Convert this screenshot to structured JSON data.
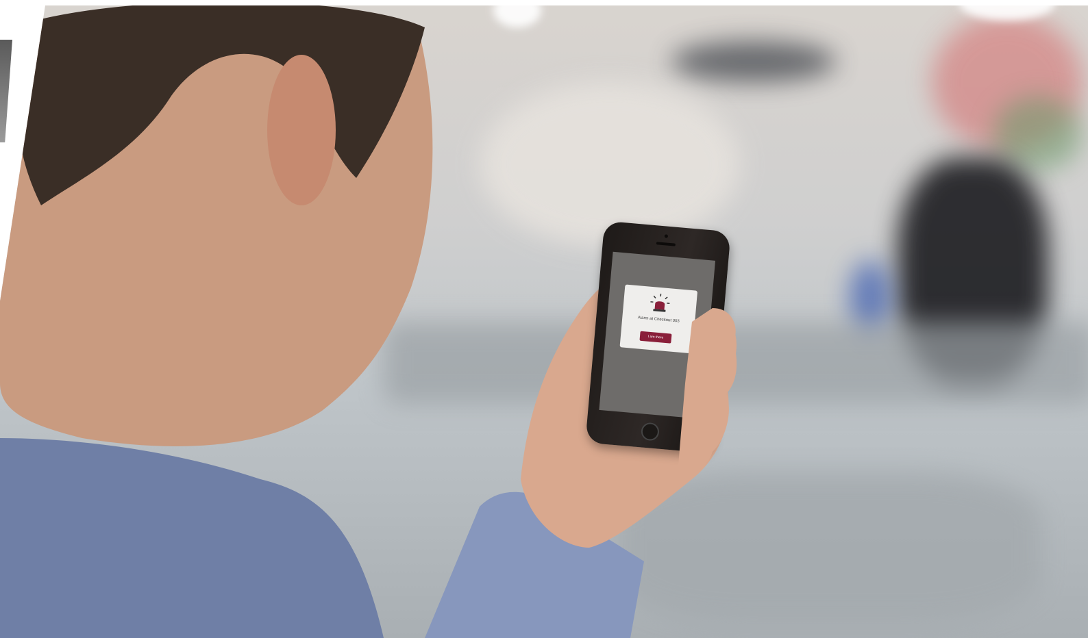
{
  "scene": {
    "description_free": true,
    "colors": {
      "shirt": "#6f7fa6",
      "skin": "#c99b80",
      "hair": "#3a2e26",
      "background_blur": "#cfcfcf",
      "phone_body": "#1e1a18",
      "alert_button": "#8a1f3a"
    }
  },
  "phone_screen": {
    "icon": "siren-icon",
    "message": "Alarm at Checkout 003",
    "button_label": "I am there"
  }
}
